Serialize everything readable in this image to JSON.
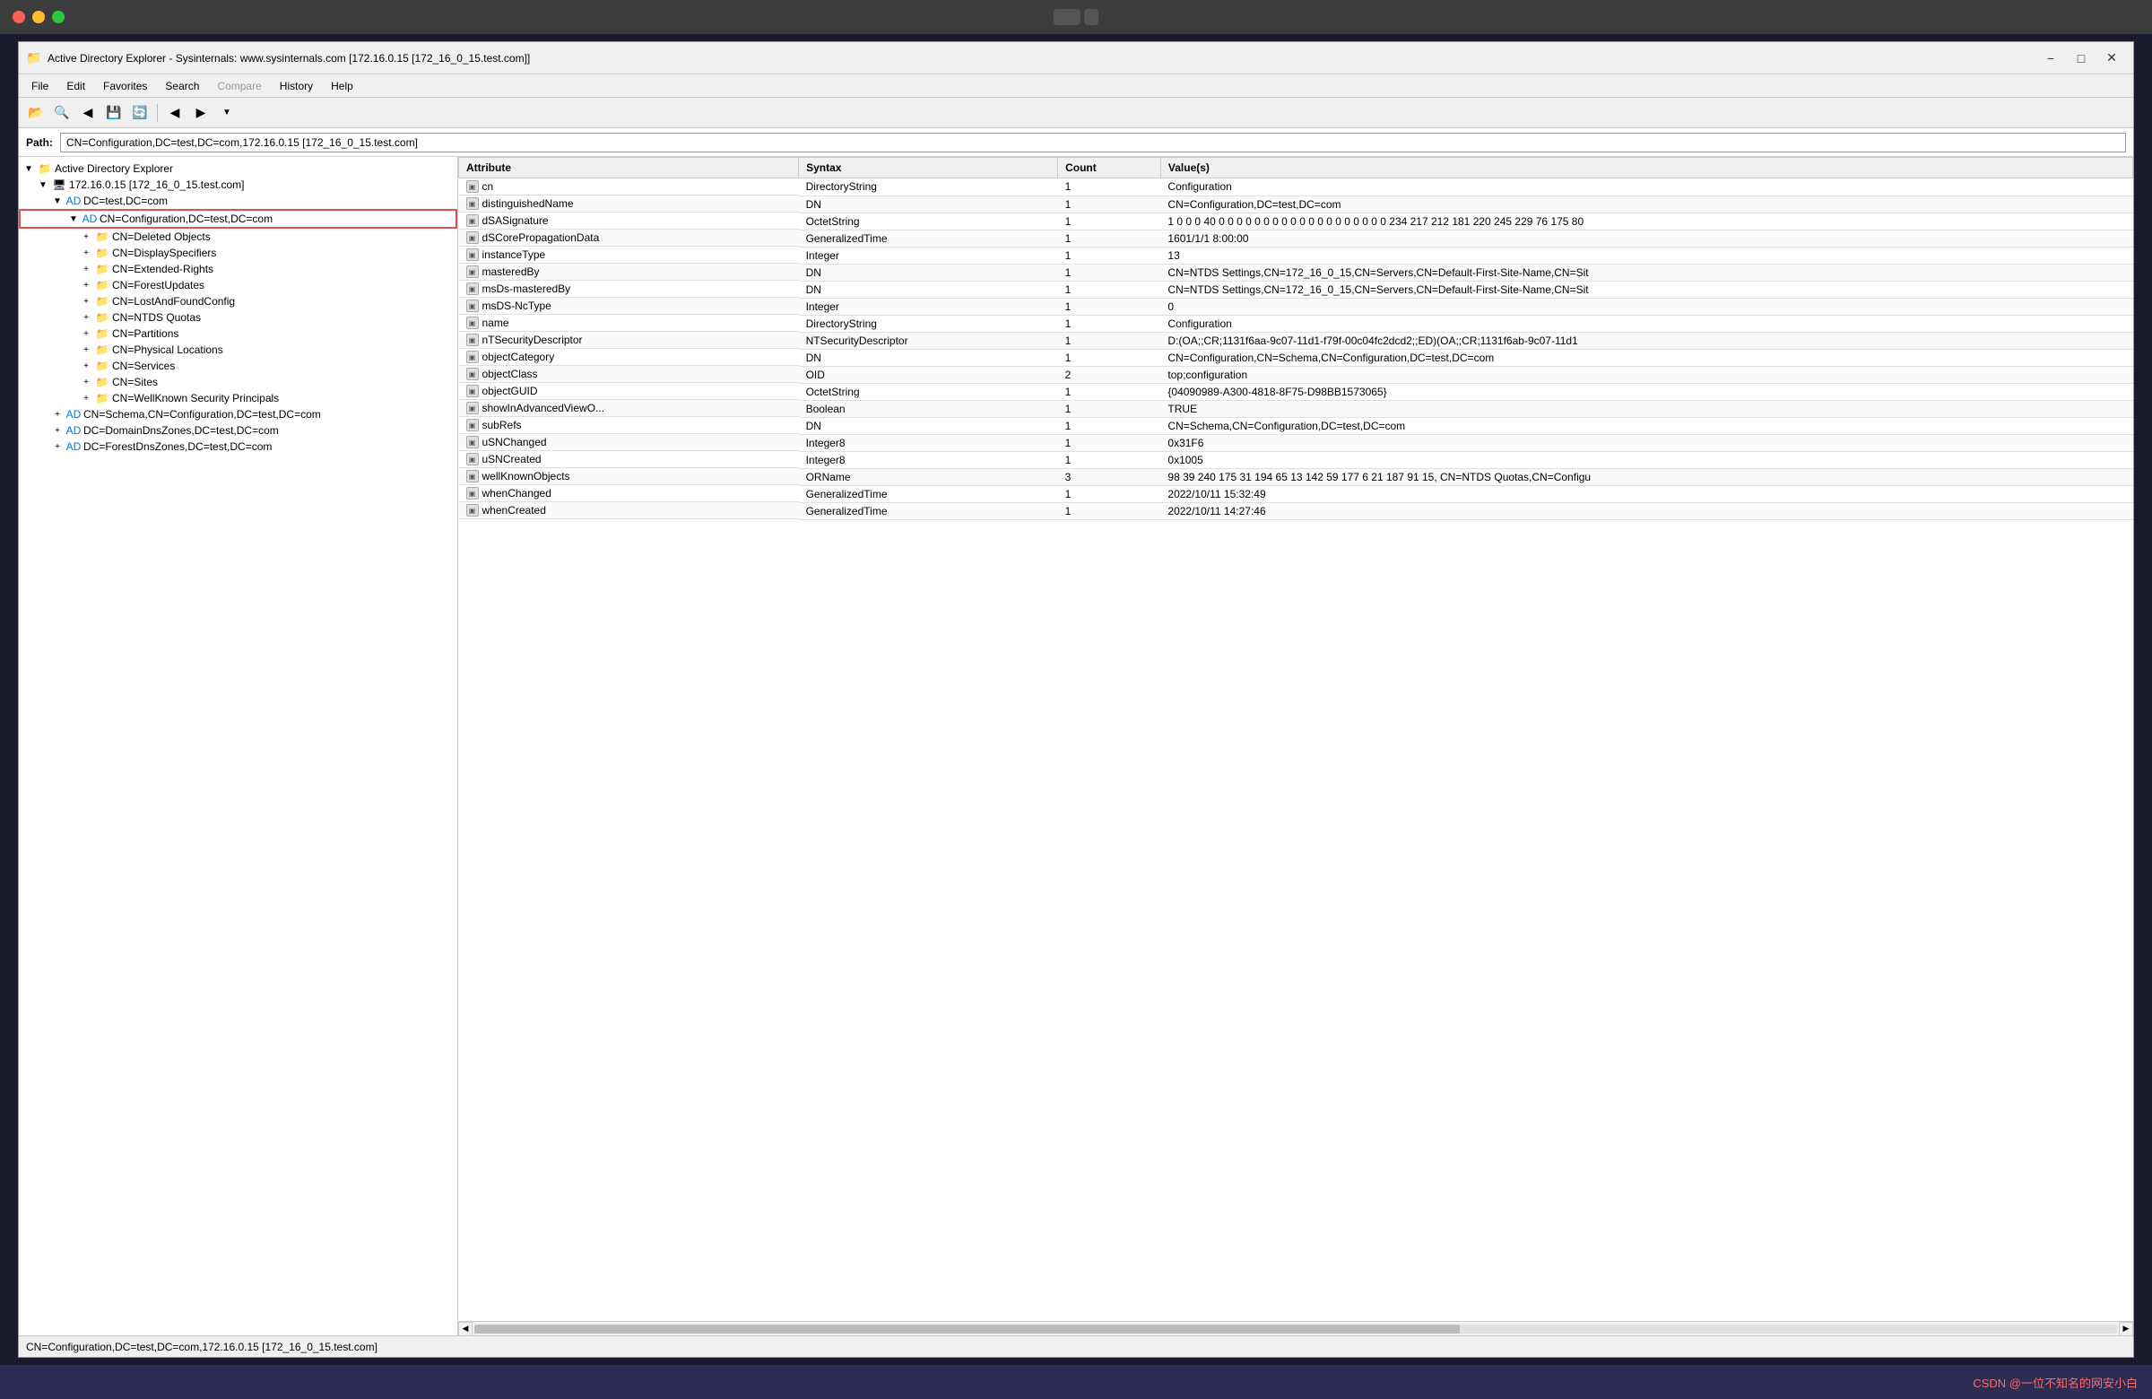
{
  "titlebar": {
    "window_title": "Active Directory Explorer - Sysinternals: www.sysinternals.com [172.16.0.15 [172_16_0_15.test.com]]",
    "app_icon": "AD"
  },
  "menu": {
    "items": [
      "File",
      "Edit",
      "Favorites",
      "Search",
      "Compare",
      "History",
      "Help"
    ]
  },
  "toolbar": {
    "buttons": [
      "open",
      "search",
      "back-prev",
      "save",
      "refresh",
      "back",
      "forward",
      "dropdown"
    ]
  },
  "pathbar": {
    "label": "Path:",
    "value": "CN=Configuration,DC=test,DC=com,172.16.0.15 [172_16_0_15.test.com]"
  },
  "tree": {
    "root_label": "Active Directory Explorer",
    "nodes": [
      {
        "id": "root",
        "label": "Active Directory Explorer",
        "indent": 0,
        "type": "root",
        "expanded": true
      },
      {
        "id": "server",
        "label": "172.16.0.15 [172_16_0_15.test.com]",
        "indent": 1,
        "type": "server",
        "expanded": true
      },
      {
        "id": "dc_test",
        "label": "DC=test,DC=com",
        "indent": 2,
        "type": "folder",
        "expanded": true
      },
      {
        "id": "cn_config",
        "label": "CN=Configuration,DC=test,DC=com",
        "indent": 3,
        "type": "folder",
        "expanded": true,
        "selected": true,
        "highlighted": true
      },
      {
        "id": "cn_deleted",
        "label": "CN=Deleted Objects",
        "indent": 4,
        "type": "folder"
      },
      {
        "id": "cn_display",
        "label": "CN=DisplaySpecifiers",
        "indent": 4,
        "type": "folder"
      },
      {
        "id": "cn_extended",
        "label": "CN=Extended-Rights",
        "indent": 4,
        "type": "folder"
      },
      {
        "id": "cn_forest",
        "label": "CN=ForestUpdates",
        "indent": 4,
        "type": "folder"
      },
      {
        "id": "cn_lostandfound",
        "label": "CN=LostAndFoundConfig",
        "indent": 4,
        "type": "folder"
      },
      {
        "id": "cn_ntds",
        "label": "CN=NTDS Quotas",
        "indent": 4,
        "type": "folder"
      },
      {
        "id": "cn_partitions",
        "label": "CN=Partitions",
        "indent": 4,
        "type": "folder"
      },
      {
        "id": "cn_physical",
        "label": "CN=Physical Locations",
        "indent": 4,
        "type": "folder"
      },
      {
        "id": "cn_services",
        "label": "CN=Services",
        "indent": 4,
        "type": "folder"
      },
      {
        "id": "cn_sites",
        "label": "CN=Sites",
        "indent": 4,
        "type": "folder"
      },
      {
        "id": "cn_wellknown",
        "label": "CN=WellKnown Security Principals",
        "indent": 4,
        "type": "folder"
      },
      {
        "id": "cn_schema",
        "label": "CN=Schema,CN=Configuration,DC=test,DC=com",
        "indent": 2,
        "type": "folder"
      },
      {
        "id": "dc_domaindns",
        "label": "DC=DomainDnsZones,DC=test,DC=com",
        "indent": 2,
        "type": "folder"
      },
      {
        "id": "dc_forestdns",
        "label": "DC=ForestDnsZones,DC=test,DC=com",
        "indent": 2,
        "type": "folder"
      }
    ]
  },
  "table": {
    "columns": [
      "Attribute",
      "Syntax",
      "Count",
      "Value(s)"
    ],
    "rows": [
      {
        "attr": "cn",
        "syntax": "DirectoryString",
        "count": "1",
        "value": "Configuration"
      },
      {
        "attr": "distinguishedName",
        "syntax": "DN",
        "count": "1",
        "value": "CN=Configuration,DC=test,DC=com"
      },
      {
        "attr": "dSASignature",
        "syntax": "OctetString",
        "count": "1",
        "value": "1 0 0 0 40 0 0 0 0 0 0 0 0 0 0 0 0 0 0 0 0 0 0 0 234 217 212 181 220 245 229 76 175 80"
      },
      {
        "attr": "dSCorePropagationData",
        "syntax": "GeneralizedTime",
        "count": "1",
        "value": "1601/1/1 8:00:00"
      },
      {
        "attr": "instanceType",
        "syntax": "Integer",
        "count": "1",
        "value": "13"
      },
      {
        "attr": "masteredBy",
        "syntax": "DN",
        "count": "1",
        "value": "CN=NTDS Settings,CN=172_16_0_15,CN=Servers,CN=Default-First-Site-Name,CN=Sit"
      },
      {
        "attr": "msDs-masteredBy",
        "syntax": "DN",
        "count": "1",
        "value": "CN=NTDS Settings,CN=172_16_0_15,CN=Servers,CN=Default-First-Site-Name,CN=Sit"
      },
      {
        "attr": "msDS-NcType",
        "syntax": "Integer",
        "count": "1",
        "value": "0"
      },
      {
        "attr": "name",
        "syntax": "DirectoryString",
        "count": "1",
        "value": "Configuration"
      },
      {
        "attr": "nTSecurityDescriptor",
        "syntax": "NTSecurityDescriptor",
        "count": "1",
        "value": "D:(OA;;CR;1131f6aa-9c07-11d1-f79f-00c04fc2dcd2;;ED)(OA;;CR;1131f6ab-9c07-11d1"
      },
      {
        "attr": "objectCategory",
        "syntax": "DN",
        "count": "1",
        "value": "CN=Configuration,CN=Schema,CN=Configuration,DC=test,DC=com"
      },
      {
        "attr": "objectClass",
        "syntax": "OID",
        "count": "2",
        "value": "top;configuration"
      },
      {
        "attr": "objectGUID",
        "syntax": "OctetString",
        "count": "1",
        "value": "{04090989-A300-4818-8F75-D98BB1573065}"
      },
      {
        "attr": "showInAdvancedViewO...",
        "syntax": "Boolean",
        "count": "1",
        "value": "TRUE"
      },
      {
        "attr": "subRefs",
        "syntax": "DN",
        "count": "1",
        "value": "CN=Schema,CN=Configuration,DC=test,DC=com"
      },
      {
        "attr": "uSNChanged",
        "syntax": "Integer8",
        "count": "1",
        "value": "0x31F6"
      },
      {
        "attr": "uSNCreated",
        "syntax": "Integer8",
        "count": "1",
        "value": "0x1005"
      },
      {
        "attr": "wellKnownObjects",
        "syntax": "ORName",
        "count": "3",
        "value": "98 39 240 175 31 194 65 13 142 59 177 6 21 187 91 15, CN=NTDS Quotas,CN=Configu"
      },
      {
        "attr": "whenChanged",
        "syntax": "GeneralizedTime",
        "count": "1",
        "value": "2022/10/11 15:32:49"
      },
      {
        "attr": "whenCreated",
        "syntax": "GeneralizedTime",
        "count": "1",
        "value": "2022/10/11 14:27:46"
      }
    ]
  },
  "statusbar": {
    "text": "CN=Configuration,DC=test,DC=com,172.16.0.15 [172_16_0_15.test.com]"
  },
  "bottom": {
    "label": "CSDN @一位不知名的网安小白"
  }
}
